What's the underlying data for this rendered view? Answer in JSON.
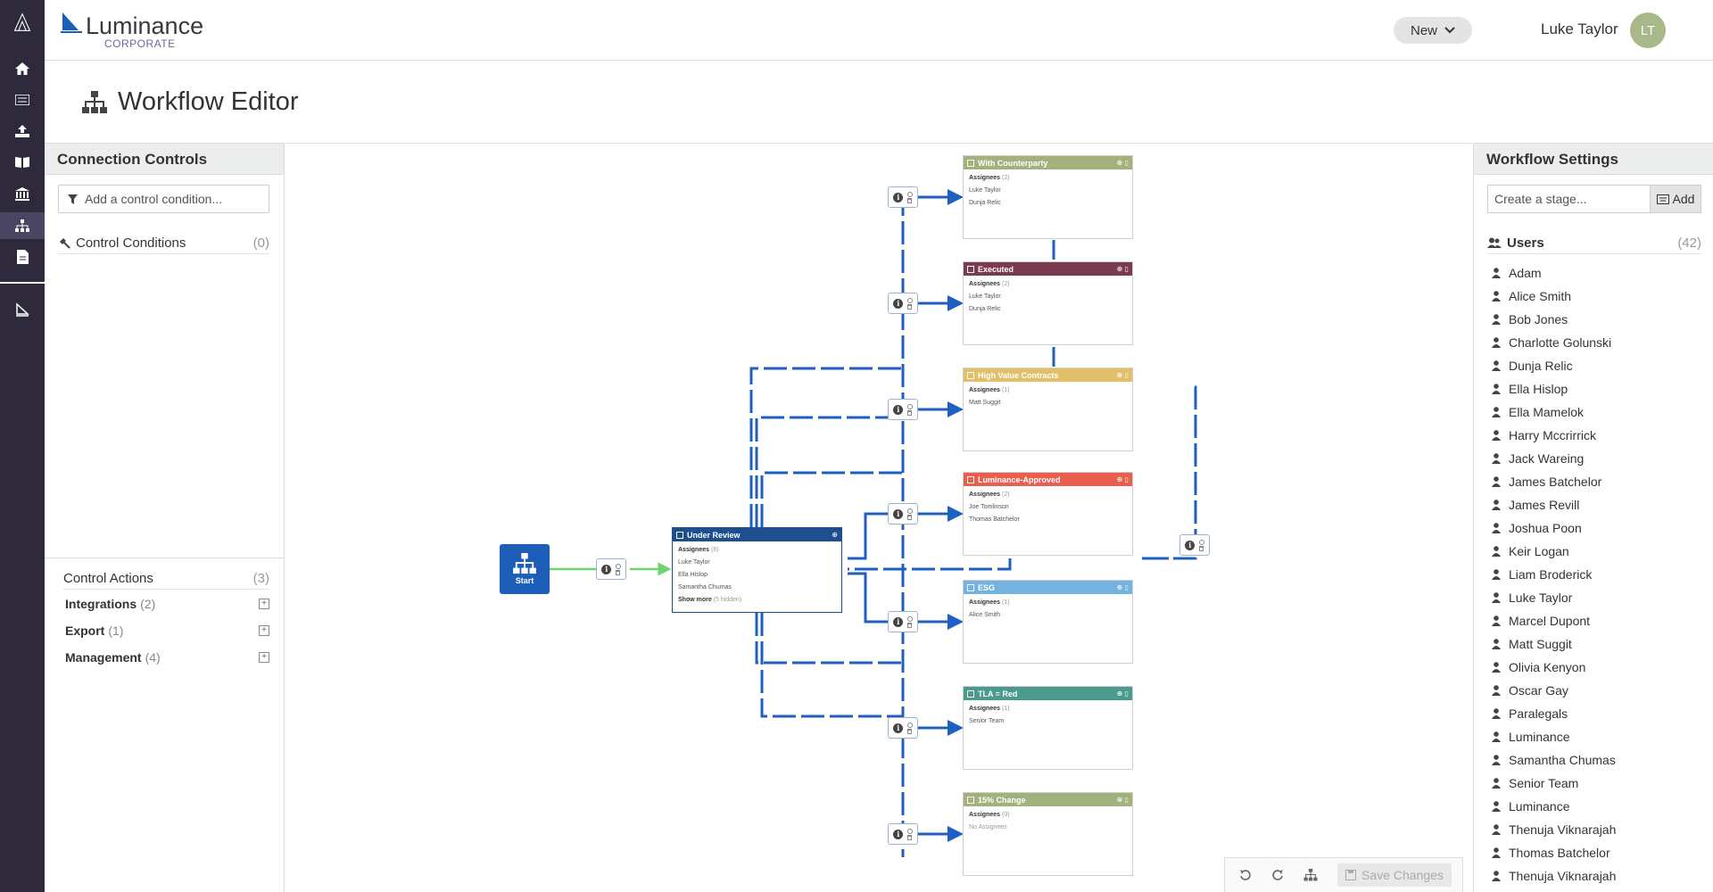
{
  "header": {
    "brand_name": "Luminance",
    "brand_sub": "CORPORATE",
    "new_label": "New",
    "user_name": "Luke Taylor",
    "avatar_initials": "LT"
  },
  "page": {
    "title": "Workflow Editor"
  },
  "left_panel": {
    "title": "Connection Controls",
    "filter_placeholder": "Add a control condition...",
    "control_conditions": {
      "label": "Control Conditions",
      "count": "(0)"
    },
    "control_actions": {
      "label": "Control Actions",
      "count": "(3)"
    },
    "action_groups": [
      {
        "label": "Integrations",
        "count": "(2)"
      },
      {
        "label": "Export",
        "count": "(1)"
      },
      {
        "label": "Management",
        "count": "(4)"
      }
    ]
  },
  "right_panel": {
    "title": "Workflow Settings",
    "stage_placeholder": "Create a stage...",
    "add_label": "Add",
    "users_label": "Users",
    "users_count": "(42)",
    "users": [
      "Adam",
      "Alice Smith",
      "Bob Jones",
      "Charlotte Golunski",
      "Dunja Relic",
      "Ella Hislop",
      "Ella Mamelok",
      "Harry Mccrirrick",
      "Jack Wareing",
      "James Batchelor",
      "James Revill",
      "Joshua Poon",
      "Keir Logan",
      "Liam Broderick",
      "Luke Taylor",
      "Marcel Dupont",
      "Matt Suggit",
      "Olivia Kenyon",
      "Oscar Gay",
      "Paralegals",
      "Luminance",
      "Samantha Chumas",
      "Senior Team",
      "Luminance",
      "Thenuja Viknarajah",
      "Thomas Batchelor",
      "Thenuja Viknarajah"
    ]
  },
  "workflow": {
    "start_label": "Start",
    "under_review": {
      "title": "Under Review",
      "assignees_label": "Assignees",
      "assignees_count": "(8)",
      "assignees": [
        "Luke Taylor",
        "Ella Hislop",
        "Samantha Chumas"
      ],
      "show_more": "Show more",
      "hidden": "(5 hidden)"
    },
    "stages": [
      {
        "title": "With Counterparty",
        "color": "#a3b17c",
        "count": "(2)",
        "assignees": [
          "Luke Taylor",
          "Dunja Relic"
        ]
      },
      {
        "title": "Executed",
        "color": "#7b3b4f",
        "count": "(2)",
        "assignees": [
          "Luke Taylor",
          "Dunja Relic"
        ]
      },
      {
        "title": "High Value Contracts",
        "color": "#e2c06a",
        "count": "(1)",
        "assignees": [
          "Matt Suggit"
        ]
      },
      {
        "title": "Luminance-Approved",
        "color": "#e8604d",
        "count": "(2)",
        "assignees": [
          "Joe Tomlinson",
          "Thomas Batchelor"
        ]
      },
      {
        "title": "ESG",
        "color": "#74b3e0",
        "count": "(1)",
        "assignees": [
          "Alice Smith"
        ]
      },
      {
        "title": "TLA = Red",
        "color": "#4a9a8e",
        "count": "(1)",
        "assignees": [
          "Senior Team"
        ]
      },
      {
        "title": "15% Change",
        "color": "#a3b17c",
        "count": "(0)",
        "assignees": [],
        "empty": "No Assignees"
      }
    ]
  },
  "toolbar": {
    "save_label": "Save Changes"
  },
  "colors": {
    "rail": "#2e2a3b",
    "connector": "#1f5fbf",
    "start_connector": "#6fd36f"
  }
}
